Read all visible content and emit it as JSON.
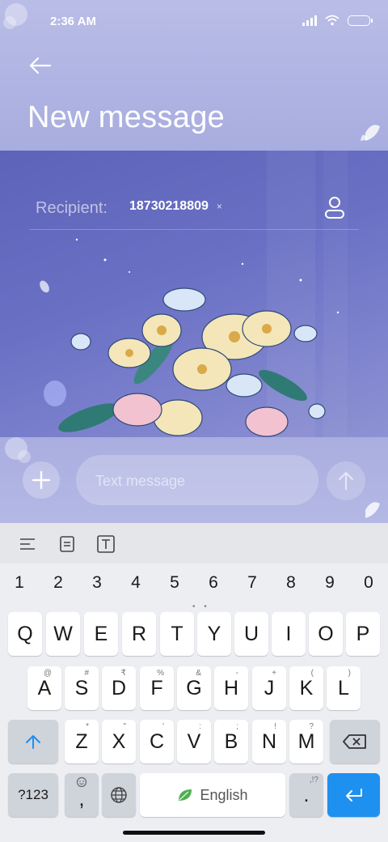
{
  "status": {
    "time": "2:36 AM"
  },
  "header": {
    "title": "New message"
  },
  "recipient": {
    "label": "Recipient:",
    "number": "18730218809",
    "remove": "×"
  },
  "composer": {
    "placeholder": "Text message"
  },
  "keyboard": {
    "numbers": [
      "1",
      "2",
      "3",
      "4",
      "5",
      "6",
      "7",
      "8",
      "9",
      "0"
    ],
    "row1": [
      "Q",
      "W",
      "E",
      "R",
      "T",
      "Y",
      "U",
      "I",
      "O",
      "P"
    ],
    "row2": [
      {
        "key": "A",
        "sup": "@"
      },
      {
        "key": "S",
        "sup": "#"
      },
      {
        "key": "D",
        "sup": "₹"
      },
      {
        "key": "F",
        "sup": "%"
      },
      {
        "key": "G",
        "sup": "&"
      },
      {
        "key": "H",
        "sup": "-"
      },
      {
        "key": "J",
        "sup": "+"
      },
      {
        "key": "K",
        "sup": "("
      },
      {
        "key": "L",
        "sup": ")"
      }
    ],
    "row3": [
      {
        "key": "Z",
        "sup": "*"
      },
      {
        "key": "X",
        "sup": "\""
      },
      {
        "key": "C",
        "sup": "'"
      },
      {
        "key": "V",
        "sup": ":"
      },
      {
        "key": "B",
        "sup": ";"
      },
      {
        "key": "N",
        "sup": "!"
      },
      {
        "key": "M",
        "sup": "?"
      }
    ],
    "symbols_label": "?123",
    "comma": ",",
    "space_label": "English",
    "period": ".",
    "period_sup": ",!?"
  },
  "colors": {
    "accent": "#1e90f0",
    "header": "#aeb3e2",
    "content": "#6a70c4"
  },
  "icons": [
    "back-arrow-icon",
    "contact-icon",
    "plus-icon",
    "send-arrow-icon",
    "align-icon",
    "clipboard-icon",
    "text-icon",
    "globe-icon",
    "leaf-icon",
    "backspace-icon",
    "shift-icon",
    "enter-icon",
    "emoji-icon"
  ]
}
